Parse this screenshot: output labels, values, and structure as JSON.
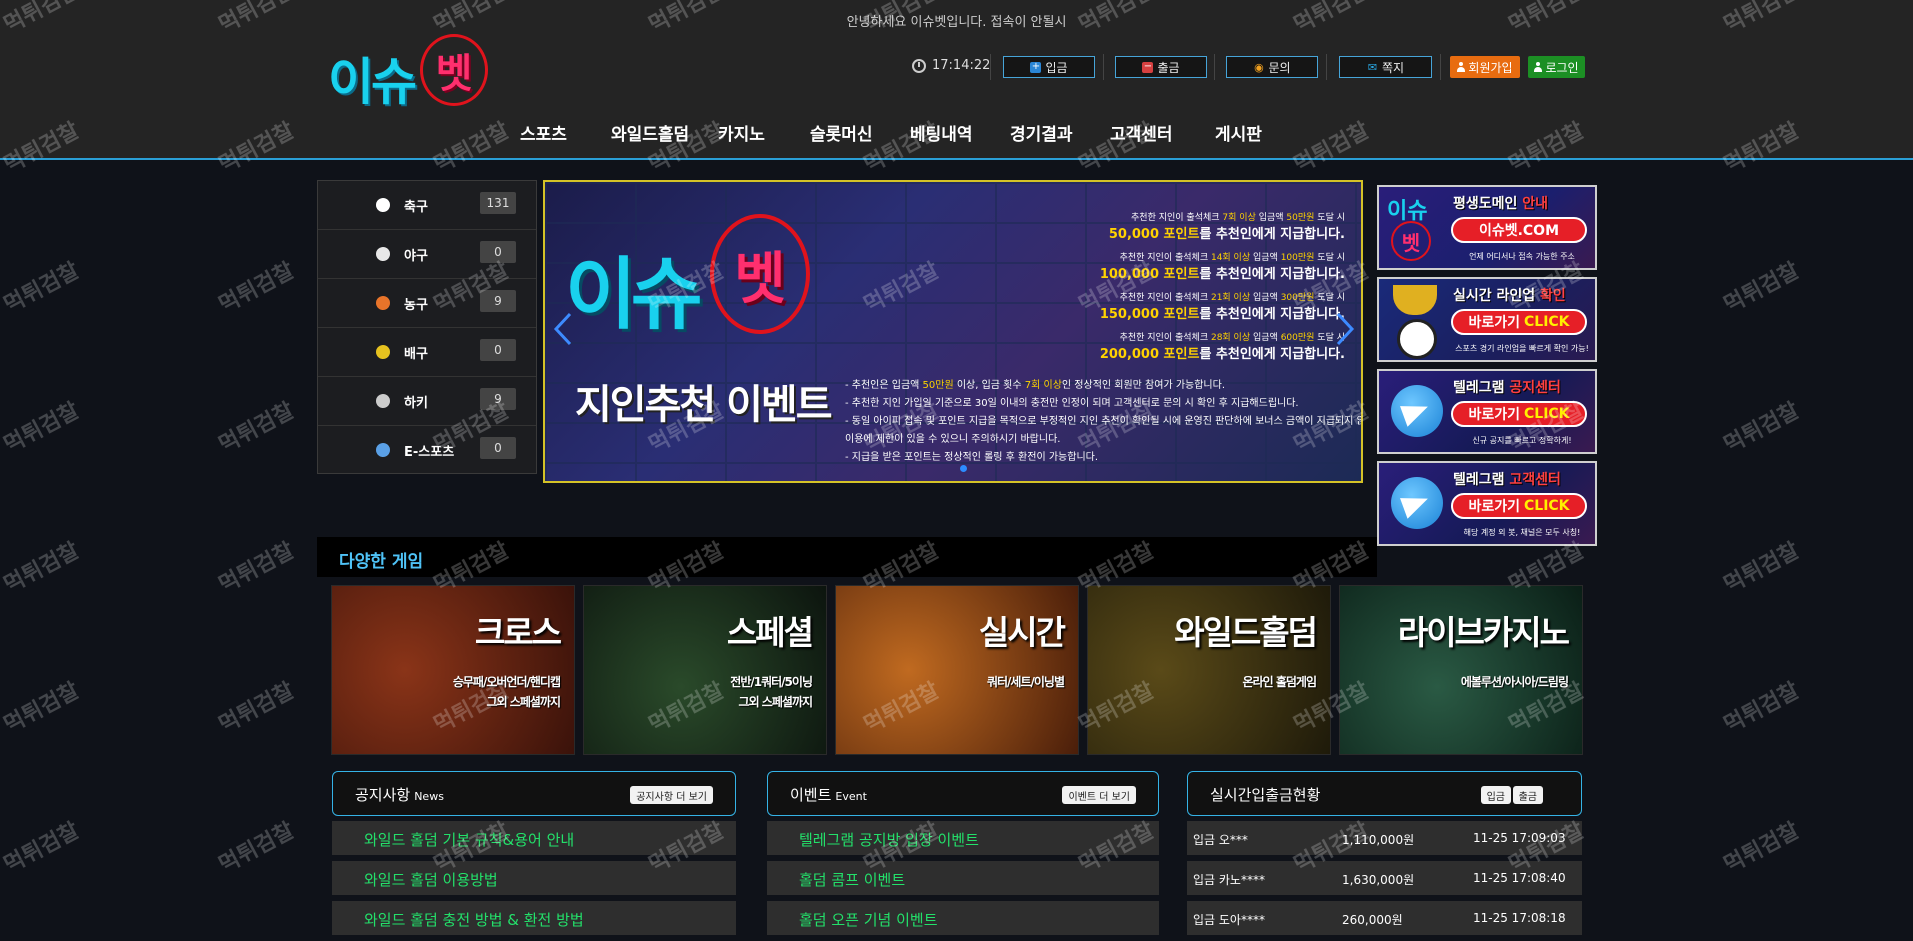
{
  "header": {
    "welcome": "안녕하세요 이슈벳입니다. 접속이 안될시",
    "logo_text": "이슈",
    "logo_mark": "벳",
    "time": "17:14:22",
    "buttons": {
      "deposit": "입금",
      "withdraw": "출금",
      "inquiry": "문의",
      "message": "쪽지",
      "signup": "회원가입",
      "login": "로그인"
    }
  },
  "nav": [
    "스포츠",
    "와일드홀덤",
    "카지노",
    "슬롯머신",
    "베팅내역",
    "경기결과",
    "고객센터",
    "게시판"
  ],
  "sports": [
    {
      "name": "축구",
      "count": "131",
      "color": "#ffffff"
    },
    {
      "name": "야구",
      "count": "0",
      "color": "#e8e8e8"
    },
    {
      "name": "농구",
      "count": "9",
      "color": "#e8742a"
    },
    {
      "name": "배구",
      "count": "0",
      "color": "#e6c21f"
    },
    {
      "name": "하키",
      "count": "9",
      "color": "#cccccc"
    },
    {
      "name": "E-스포츠",
      "count": "0",
      "color": "#5aa0e6"
    }
  ],
  "banner": {
    "logo_text": "이슈",
    "logo_mark": "벳",
    "title": "지인추천 이벤트",
    "promos": [
      {
        "small_a": "추천한 지인이 출석체크 ",
        "small_hl": "7회 이상",
        "small_b": " 입금액 ",
        "small_hl2": "50만원",
        "small_c": " 도달 시",
        "big_hl": "50,000 포인트",
        "big": "를 추천인에게 지급합니다."
      },
      {
        "small_a": "추천한 지인이 출석체크 ",
        "small_hl": "14회 이상",
        "small_b": " 입금액 ",
        "small_hl2": "100만원",
        "small_c": " 도달 시",
        "big_hl": "100,000 포인트",
        "big": "를 추천인에게 지급합니다."
      },
      {
        "small_a": "추천한 지인이 출석체크 ",
        "small_hl": "21회 이상",
        "small_b": " 입금액 ",
        "small_hl2": "300만원",
        "small_c": " 도달 시",
        "big_hl": "150,000 포인트",
        "big": "를 추천인에게 지급합니다."
      },
      {
        "small_a": "추천한 지인이 출석체크 ",
        "small_hl": "28회 이상",
        "small_b": " 입금액 ",
        "small_hl2": "600만원",
        "small_c": " 도달 시",
        "big_hl": "200,000 포인트",
        "big": "를 추천인에게 지급합니다."
      }
    ],
    "notes": [
      {
        "a": "- 추천인은 입금액 ",
        "hl": "50만원",
        "b": " 이상, 입금 횟수 ",
        "hl2": "7회 이상",
        "c": "인 정상적인 회원만 참여가 가능합니다."
      },
      {
        "a": "- 추천한 지인 가입일 기준으로 30일 이내의 충전만 인정이 되며 고객센터로 문의 시 확인 후 지급해드립니다.",
        "hl": "",
        "b": "",
        "hl2": "",
        "c": ""
      },
      {
        "a": "- 동일 아이피 접속 및 포인트 지급을 목적으로 부정적인 지인 추천이 확인될 시에 운영진 판단하에 보너스 금액이 지급되지 않고",
        "hl": "",
        "b": "",
        "hl2": "",
        "c": ""
      },
      {
        "a": "  이용에 제한이 있을 수 있으니 주의하시기 바랍니다.",
        "hl": "",
        "b": "",
        "hl2": "",
        "c": ""
      },
      {
        "a": "- 지급을 받은 포인트는 정상적인 롤링 후 환전이 가능합니다.",
        "hl": "",
        "b": "",
        "hl2": "",
        "c": ""
      }
    ]
  },
  "side_promos": [
    {
      "title": "평생도메인",
      "title_hl": " 안내",
      "pill": "이슈벳.COM",
      "pill_hl": "",
      "sub": "언제 어디서나 접속 가능한 주소",
      "bg": "#1b1f6e"
    },
    {
      "title": "실시간 라인업",
      "title_hl": " 확인",
      "pill": "바로가기",
      "pill_hl": "CLICK",
      "sub": "스포츠 경기 라인업을 빠르게 확인 가능!",
      "bg": "#1a1f5e"
    },
    {
      "title": "텔레그램",
      "title_hl": " 공지센터",
      "pill": "바로가기",
      "pill_hl": "CLICK",
      "sub": "신규 공지를 빠르고 정확하게!",
      "bg": "#151a56"
    },
    {
      "title": "텔레그램",
      "title_hl": " 고객센터",
      "pill": "바로가기",
      "pill_hl": "CLICK",
      "sub": "해당 계정 외 봇, 채널은 모두 사칭!",
      "bg": "#151a56"
    }
  ],
  "games": {
    "section_title": "다양한 게임",
    "cards": [
      {
        "title": "크로스",
        "sub1": "승무패/오버언더/핸디캡",
        "sub2": "그외 스페셜까지",
        "bg": "#6b2414"
      },
      {
        "title": "스페셜",
        "sub1": "전반/1쿼터/5이닝",
        "sub2": "그외 스페셜까지",
        "bg": "#1d2a1f"
      },
      {
        "title": "실시간",
        "sub1": "쿼터/세트/이닝별",
        "sub2": "",
        "bg": "#7a3a16"
      },
      {
        "title": "와일드홀덤",
        "sub1": "온라인 홀덤게임",
        "sub2": "",
        "bg": "#3a3416"
      },
      {
        "title": "라이브카지노",
        "sub1": "에볼루션/아시아/드림링",
        "sub2": "",
        "bg": "#1c3a2c"
      }
    ]
  },
  "notice": {
    "title": "공지사항",
    "sub": "News",
    "more": "공지사항 더 보기",
    "items": [
      "와일드 홀덤 기본 규칙&용어 안내",
      "와일드 홀덤 이용방법",
      "와일드 홀덤 충전 방법 & 환전 방법"
    ]
  },
  "events": {
    "title": "이벤트",
    "sub": "Event",
    "more": "이벤트 더 보기",
    "items": [
      "텔레그램 공지방 입장 이벤트",
      "홀덤 콤프 이벤트",
      "홀덤 오픈 기념 이벤트"
    ]
  },
  "realtime": {
    "title": "실시간입출금현황",
    "tab_deposit": "입금",
    "tab_withdraw": "출금",
    "rows": [
      {
        "user": "입금 오***",
        "amount": "1,110,000원",
        "time": "11-25 17:09:03"
      },
      {
        "user": "입금 카노****",
        "amount": "1,630,000원",
        "time": "11-25 17:08:40"
      },
      {
        "user": "입금 도아****",
        "amount": "260,000원",
        "time": "11-25 17:08:18"
      }
    ]
  },
  "watermark": "먹튀검찰",
  "colors": {
    "accent": "#2a9fd6",
    "green_text": "#23e06a",
    "signup": "#e86c10",
    "login": "#1c8f24"
  }
}
